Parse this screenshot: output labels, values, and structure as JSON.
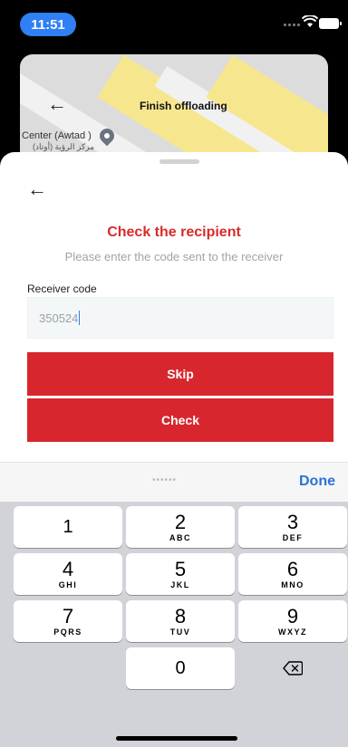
{
  "status_bar": {
    "time": "11:51",
    "time_pill_color": "#2f7ff5"
  },
  "map": {
    "title": "Finish offloading",
    "place_name": "Center (Awtad )",
    "place_name_ar": "مركز الرؤية (أوتاد)"
  },
  "sheet": {
    "title": "Check the recipient",
    "subtitle": "Please enter the code sent to the receiver",
    "field_label": "Receiver code",
    "code_value": "350524",
    "skip_label": "Skip",
    "check_label": "Check",
    "accent_color": "#d8262e"
  },
  "keyboard": {
    "accessory_dots": "••••••",
    "done_label": "Done",
    "keys": [
      {
        "num": "1",
        "letters": ""
      },
      {
        "num": "2",
        "letters": "ABC"
      },
      {
        "num": "3",
        "letters": "DEF"
      },
      {
        "num": "4",
        "letters": "GHI"
      },
      {
        "num": "5",
        "letters": "JKL"
      },
      {
        "num": "6",
        "letters": "MNO"
      },
      {
        "num": "7",
        "letters": "PQRS"
      },
      {
        "num": "8",
        "letters": "TUV"
      },
      {
        "num": "9",
        "letters": "WXYZ"
      },
      {
        "num": "0",
        "letters": ""
      }
    ],
    "backspace_icon": "delete-backward-icon"
  }
}
